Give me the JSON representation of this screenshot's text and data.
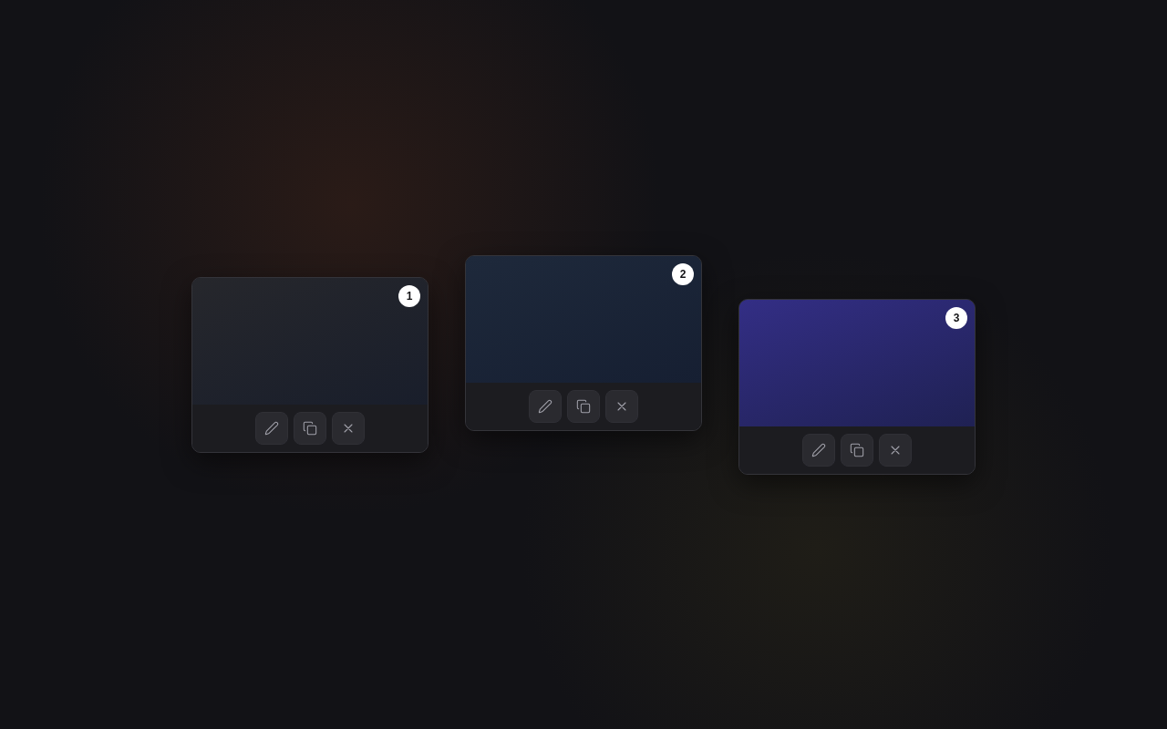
{
  "cards": [
    {
      "number": "1",
      "color": "#26272c"
    },
    {
      "number": "2",
      "color": "#1e293b"
    },
    {
      "number": "3",
      "color": "#332e85"
    }
  ]
}
